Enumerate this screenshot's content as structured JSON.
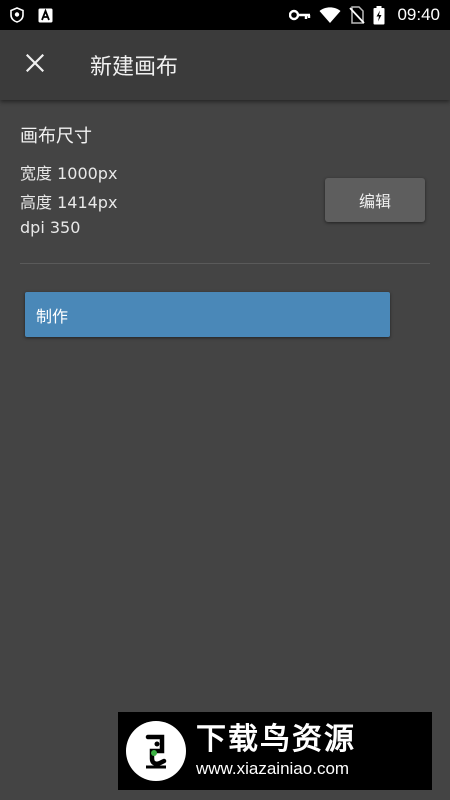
{
  "status_bar": {
    "time": "09:40",
    "icons_left": [
      "shield-icon",
      "app-a-icon"
    ],
    "icons_right": [
      "key-icon",
      "wifi-icon",
      "no-sim-icon",
      "battery-charging-icon"
    ]
  },
  "app_bar": {
    "close_icon": "close-icon",
    "title": "新建画布"
  },
  "canvas_size": {
    "section_title": "画布尺寸",
    "width_line": "宽度 1000px",
    "height_line": "高度 1414px",
    "dpi_line": "dpi 350",
    "edit_label": "编辑"
  },
  "actions": {
    "make_label": "制作"
  },
  "watermark": {
    "title": "下载鸟资源",
    "url": "www.xiazainiao.com"
  },
  "colors": {
    "background": "#444444",
    "app_bar": "#3b3b3b",
    "primary_button": "#4a88b8",
    "secondary_button": "#5e5e5e"
  }
}
